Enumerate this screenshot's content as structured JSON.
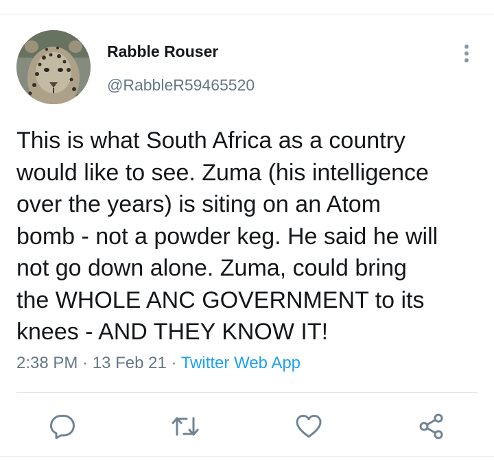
{
  "tweet": {
    "author": {
      "display_name": "Rabble Rouser",
      "handle": "@RabbleR59465520",
      "avatar": "leopard-avatar"
    },
    "text_lines": [
      "This is what South Africa as a country",
      "would like to see. Zuma (his intelligence",
      "over the years) is siting on an Atom",
      "bomb - not a powder keg. He said he will",
      "not go down alone. Zuma, could bring",
      "the WHOLE ANC GOVERNMENT to its",
      "knees - AND THEY KNOW IT!"
    ],
    "time": "2:38 PM",
    "separator": " · ",
    "date": "13 Feb 21",
    "source": "Twitter Web App"
  },
  "actions": {
    "reply": "reply-icon",
    "retweet": "retweet-icon",
    "like": "heart-icon",
    "share": "share-icon"
  },
  "colors": {
    "text": "#14171a",
    "secondary": "#657786",
    "link": "#1da1f2",
    "icon": "#6e8394",
    "divider": "#e1e8ed"
  }
}
